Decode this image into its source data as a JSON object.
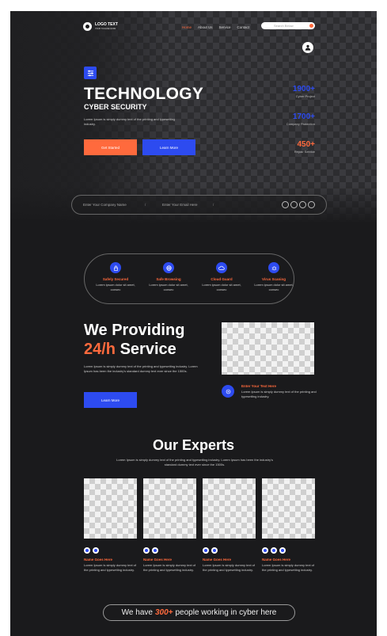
{
  "header": {
    "logo_text": "LOGO TEXT",
    "logo_sub": "YOUR TAGLINE HERE",
    "nav": [
      {
        "label": "Home",
        "active": true
      },
      {
        "label": "About Us",
        "active": false
      },
      {
        "label": "Service",
        "active": false
      },
      {
        "label": "Contact",
        "active": false
      }
    ],
    "search_placeholder": "Search Below"
  },
  "hero": {
    "title": "TECHNOLOGY",
    "subtitle": "CYBER SECURITY",
    "description": "Lorem Ipsum is simply dummy text of the printing and typesetting industry.",
    "primary_button": "Get Started",
    "secondary_button": "Learn More",
    "stats": [
      {
        "value": "1900+",
        "label": "Cyber Project",
        "color": "#2d4bf0"
      },
      {
        "value": "1700+",
        "label": "Company Protection",
        "color": "#2d4bf0"
      },
      {
        "value": "450+",
        "label": "Repair Service",
        "color": "#ff6a3d"
      }
    ]
  },
  "form_bar": {
    "field1": "Enter Your Company Name",
    "field2": "Enter Your Email Here"
  },
  "features": [
    {
      "title": "Safely Secured",
      "desc": "Lorem ipsum dolor sit amet, consec",
      "icon": "lock-icon"
    },
    {
      "title": "Safe Browsing",
      "desc": "Lorem ipsum dolor sit amet, consec",
      "icon": "globe-icon"
    },
    {
      "title": "Cloud Guard",
      "desc": "Lorem ipsum dolor sit amet, consec",
      "icon": "cloud-icon"
    },
    {
      "title": "Virus Scaning",
      "desc": "Lorem ipsum dolor sit amet, consec",
      "icon": "bug-icon"
    }
  ],
  "providing": {
    "line1": "We Providing",
    "line2_highlight": "24/h",
    "line2_rest": "Service",
    "description": "Lorem Ipsum is simply dummy text of the printing and typesetting industry. Lorem Ipsum has been the industry's standard dummy text ever since the 1500s.",
    "button": "Learn More",
    "callout_title": "Enter Your Text Here",
    "callout_desc": "Lorem Ipsum is simply dummy text of the printing and typesetting industry."
  },
  "experts": {
    "title": "Our Experts",
    "description": "Lorem Ipsum is simply dummy text of the printing and typesetting industry. Lorem Ipsum has been the industry's standard dummy text ever since the 1500s.",
    "cards": [
      {
        "name": "Name Goes Here",
        "desc": "Lorem Ipsum is simply dummy text of the printing and typesetting industry."
      },
      {
        "name": "Name Goes Here",
        "desc": "Lorem Ipsum is simply dummy text of the printing and typesetting industry."
      },
      {
        "name": "Name Goes Here",
        "desc": "Lorem Ipsum is simply dummy text of the printing and typesetting industry."
      },
      {
        "name": "Name Goes Here",
        "desc": "Lorem Ipsum is simply dummy text of the printing and typesetting industry."
      }
    ]
  },
  "footer_pill": {
    "prefix": "We have",
    "highlight": "300+",
    "suffix": "people working in cyber here"
  },
  "colors": {
    "accent_orange": "#ff6a3d",
    "accent_blue": "#2d4bf0",
    "background": "#1a1a1c"
  }
}
